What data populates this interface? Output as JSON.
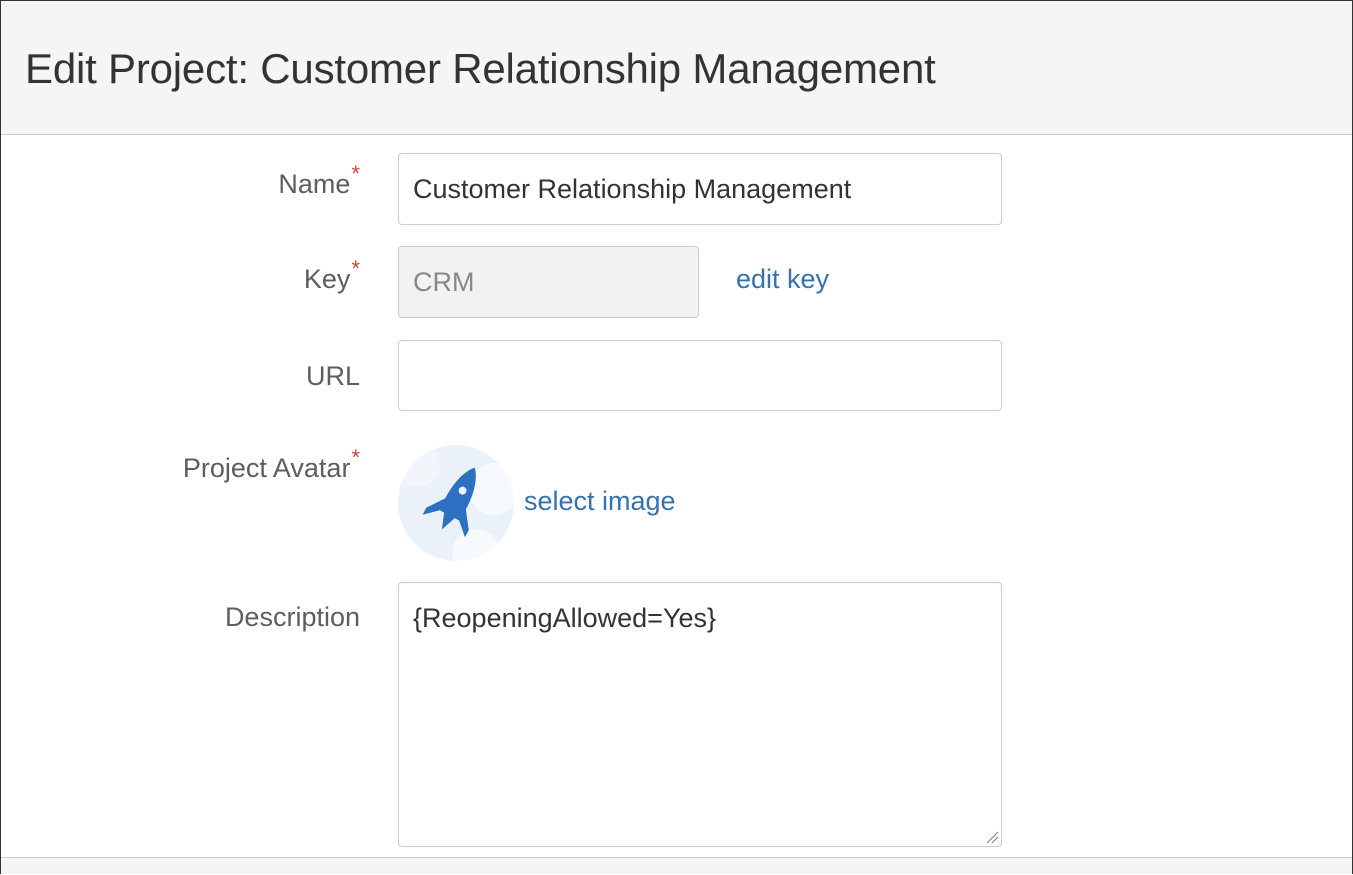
{
  "dialog": {
    "title": "Edit Project: Customer Relationship Management"
  },
  "form": {
    "required_marker": "*",
    "name": {
      "label": "Name",
      "value": "Customer Relationship Management",
      "required": true
    },
    "key": {
      "label": "Key",
      "value": "CRM",
      "required": true,
      "disabled": true,
      "edit_link": "edit key"
    },
    "url": {
      "label": "URL",
      "value": "",
      "required": false
    },
    "avatar": {
      "label": "Project Avatar",
      "required": true,
      "select_link": "select image",
      "icon": "rocket-icon"
    },
    "description": {
      "label": "Description",
      "value": "{ReopeningAllowed=Yes}",
      "required": false
    }
  },
  "colors": {
    "required": "#d04437",
    "link": "#3572b0",
    "label": "#5e5e5e",
    "header_bg": "#f5f5f5",
    "disabled_bg": "#f2f2f2",
    "avatar_bg": "#eaf1f9",
    "rocket": "#2d6fc0"
  }
}
